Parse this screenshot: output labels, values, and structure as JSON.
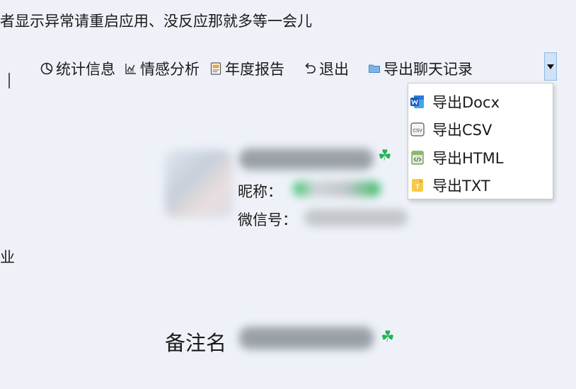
{
  "notice_text": "者显示异常请重启应用、没反应那就多等一会儿",
  "side_char": "业",
  "toolbar": {
    "stats_label": "统计信息",
    "sentiment_label": "情感分析",
    "annual_report_label": "年度报告",
    "logout_label": "退出",
    "export_label": "导出聊天记录"
  },
  "dropdown": {
    "items": [
      {
        "label": "导出Docx",
        "icon": "word-icon"
      },
      {
        "label": "导出CSV",
        "icon": "csv-icon"
      },
      {
        "label": "导出HTML",
        "icon": "html-icon"
      },
      {
        "label": "导出TXT",
        "icon": "txt-icon"
      }
    ]
  },
  "profile": {
    "nickname_label": "昵称：",
    "wechat_id_label": "微信号：",
    "remark_label": "备注名",
    "clover_icon": "☘",
    "accent_color": "#22b357"
  }
}
